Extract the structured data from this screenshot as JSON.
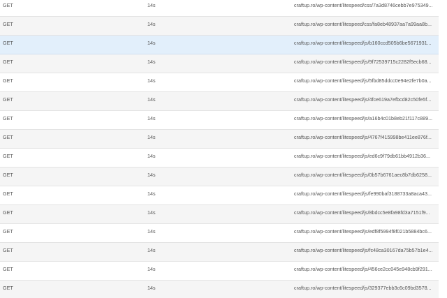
{
  "network_log": {
    "selected_row": 2,
    "rows": [
      {
        "method": "GET",
        "time": "14s",
        "url": "craftup.ro/wp-content/litespeed/css/7a3d8746cebb7e975349..."
      },
      {
        "method": "GET",
        "time": "14s",
        "url": "craftup.ro/wp-content/litespeed/css/fa8eb48937aa7a99aa8b..."
      },
      {
        "method": "GET",
        "time": "14s",
        "url": "craftup.ro/wp-content/litespeed/js/b160ccd505b6be5671931..."
      },
      {
        "method": "GET",
        "time": "14s",
        "url": "craftup.ro/wp-content/litespeed/js/9f72539715c2282f5ecb68..."
      },
      {
        "method": "GET",
        "time": "14s",
        "url": "craftup.ro/wp-content/litespeed/js/5fbd85ddcc0e94e2fe7b0a..."
      },
      {
        "method": "GET",
        "time": "14s",
        "url": "craftup.ro/wp-content/litespeed/js/4fce619a7efbcd82c50fe5f..."
      },
      {
        "method": "GET",
        "time": "14s",
        "url": "craftup.ro/wp-content/litespeed/js/a16b4c01b8eb21f117c889..."
      },
      {
        "method": "GET",
        "time": "14s",
        "url": "craftup.ro/wp-content/litespeed/js/4767f415998be411ee876f..."
      },
      {
        "method": "GET",
        "time": "14s",
        "url": "craftup.ro/wp-content/litespeed/js/ed6c9f79db61bb4912b36..."
      },
      {
        "method": "GET",
        "time": "14s",
        "url": "craftup.ro/wp-content/litespeed/js/0b57b6761aec8b7db6258..."
      },
      {
        "method": "GET",
        "time": "14s",
        "url": "craftup.ro/wp-content/litespeed/js/fe990baf3188733a8aca43..."
      },
      {
        "method": "GET",
        "time": "14s",
        "url": "craftup.ro/wp-content/litespeed/js/8bdcc5e8fa98fd3a7151f9..."
      },
      {
        "method": "GET",
        "time": "14s",
        "url": "craftup.ro/wp-content/litespeed/js/edf8f5994f8f021b5884bc6..."
      },
      {
        "method": "GET",
        "time": "14s",
        "url": "craftup.ro/wp-content/litespeed/js/fc48ca30167da75b57b1e4..."
      },
      {
        "method": "GET",
        "time": "14s",
        "url": "craftup.ro/wp-content/litespeed/js/456ce2cc045e948cb9f291..."
      },
      {
        "method": "GET",
        "time": "14s",
        "url": "craftup.ro/wp-content/litespeed/js/329377ebb3c6c09bd3578..."
      }
    ]
  }
}
